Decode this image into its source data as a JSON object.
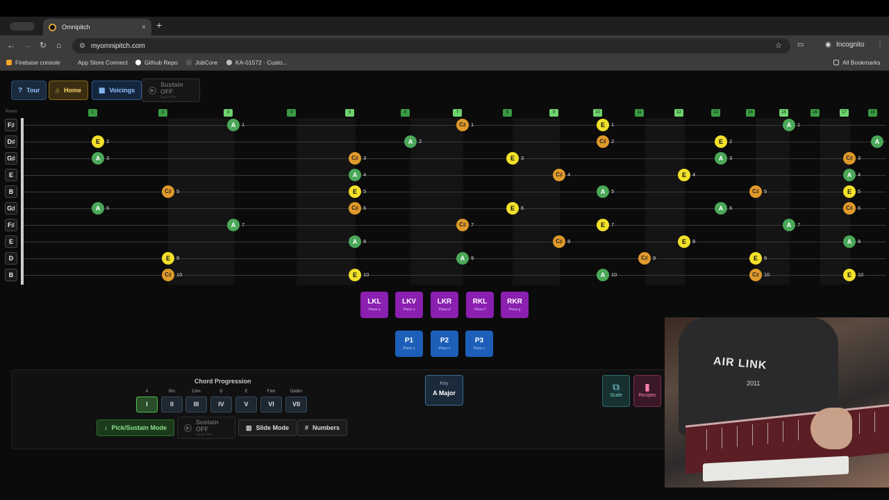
{
  "browser": {
    "tab_title": "Omnipitch",
    "tab_close": "×",
    "new_tab": "+",
    "url": "myomnipitch.com",
    "incognito": "Incognito",
    "bookmarks": [
      {
        "label": "Firebase console",
        "color": "#f5a623"
      },
      {
        "label": "App Store Connect",
        "color": "#3a3a3a"
      },
      {
        "label": "Github Repo",
        "color": "#ffffff"
      },
      {
        "label": "JobCore",
        "color": "#555555"
      },
      {
        "label": "KA-01572 · Custo...",
        "color": "#bbbbbb"
      }
    ],
    "all_bookmarks": "All Bookmarks"
  },
  "top_buttons": {
    "tour": "Tour",
    "home": "Home",
    "voicings": "Voicings",
    "sustain": "Sustain OFF",
    "sustain_sub": "Space Bar"
  },
  "press_label": "Press",
  "frets": [
    "1",
    "2",
    "3",
    "4",
    "5",
    "6",
    "7",
    "8",
    "9",
    "10",
    "11",
    "12",
    "13",
    "14",
    "15",
    "16",
    "17",
    "18"
  ],
  "strings": [
    "F♯",
    "D♯",
    "G♯",
    "E",
    "B",
    "G♯",
    "F♯",
    "E",
    "D",
    "B"
  ],
  "notes": [
    {
      "s": 0,
      "f": 3,
      "n": "A",
      "d": "1"
    },
    {
      "s": 0,
      "f": 7,
      "n": "C♯",
      "d": "1"
    },
    {
      "s": 0,
      "f": 10,
      "n": "E",
      "d": "1"
    },
    {
      "s": 0,
      "f": 15,
      "n": "A",
      "d": "1"
    },
    {
      "s": 1,
      "f": 1,
      "n": "E",
      "d": "2"
    },
    {
      "s": 1,
      "f": 6,
      "n": "A",
      "d": "2"
    },
    {
      "s": 1,
      "f": 10,
      "n": "C♯",
      "d": "2"
    },
    {
      "s": 1,
      "f": 13,
      "n": "E",
      "d": "2"
    },
    {
      "s": 1,
      "f": 18,
      "n": "A",
      "d": ""
    },
    {
      "s": 2,
      "f": 1,
      "n": "A",
      "d": "3"
    },
    {
      "s": 2,
      "f": 5,
      "n": "C♯",
      "d": "3"
    },
    {
      "s": 2,
      "f": 8,
      "n": "E",
      "d": "3"
    },
    {
      "s": 2,
      "f": 13,
      "n": "A",
      "d": "3"
    },
    {
      "s": 2,
      "f": 17,
      "n": "C♯",
      "d": "3"
    },
    {
      "s": 3,
      "f": 5,
      "n": "A",
      "d": "4"
    },
    {
      "s": 3,
      "f": 9,
      "n": "C♯",
      "d": "4"
    },
    {
      "s": 3,
      "f": 12,
      "n": "E",
      "d": "4"
    },
    {
      "s": 3,
      "f": 17,
      "n": "A",
      "d": "4"
    },
    {
      "s": 4,
      "f": 2,
      "n": "C♯",
      "d": "5"
    },
    {
      "s": 4,
      "f": 5,
      "n": "E",
      "d": "5"
    },
    {
      "s": 4,
      "f": 10,
      "n": "A",
      "d": "5"
    },
    {
      "s": 4,
      "f": 14,
      "n": "C♯",
      "d": "5"
    },
    {
      "s": 4,
      "f": 17,
      "n": "E",
      "d": "5"
    },
    {
      "s": 5,
      "f": 1,
      "n": "A",
      "d": "6"
    },
    {
      "s": 5,
      "f": 5,
      "n": "C♯",
      "d": "6"
    },
    {
      "s": 5,
      "f": 8,
      "n": "E",
      "d": "6"
    },
    {
      "s": 5,
      "f": 13,
      "n": "A",
      "d": "6"
    },
    {
      "s": 5,
      "f": 17,
      "n": "C♯",
      "d": "6"
    },
    {
      "s": 6,
      "f": 3,
      "n": "A",
      "d": "7"
    },
    {
      "s": 6,
      "f": 7,
      "n": "C♯",
      "d": "7"
    },
    {
      "s": 6,
      "f": 10,
      "n": "E",
      "d": "7"
    },
    {
      "s": 6,
      "f": 15,
      "n": "A",
      "d": "7"
    },
    {
      "s": 7,
      "f": 5,
      "n": "A",
      "d": "8"
    },
    {
      "s": 7,
      "f": 9,
      "n": "C♯",
      "d": "8"
    },
    {
      "s": 7,
      "f": 12,
      "n": "E",
      "d": "8"
    },
    {
      "s": 7,
      "f": 17,
      "n": "A",
      "d": "8"
    },
    {
      "s": 8,
      "f": 2,
      "n": "E",
      "d": "9"
    },
    {
      "s": 8,
      "f": 7,
      "n": "A",
      "d": "9"
    },
    {
      "s": 8,
      "f": 11,
      "n": "C♯",
      "d": "9"
    },
    {
      "s": 8,
      "f": 14,
      "n": "E",
      "d": "9"
    },
    {
      "s": 9,
      "f": 2,
      "n": "C♯",
      "d": "10"
    },
    {
      "s": 9,
      "f": 5,
      "n": "E",
      "d": "10"
    },
    {
      "s": 9,
      "f": 10,
      "n": "A",
      "d": "10"
    },
    {
      "s": 9,
      "f": 14,
      "n": "C♯",
      "d": "10"
    },
    {
      "s": 9,
      "f": 17,
      "n": "E",
      "d": "10"
    }
  ],
  "pedals": [
    {
      "label": "LKL",
      "key": "Press a"
    },
    {
      "label": "LKV",
      "key": "Press s"
    },
    {
      "label": "LKR",
      "key": "Press d"
    },
    {
      "label": "RKL",
      "key": "Press f"
    },
    {
      "label": "RKR",
      "key": "Press g"
    }
  ],
  "pedals_p": [
    {
      "label": "P1",
      "key": "Press z"
    },
    {
      "label": "P2",
      "key": "Press x"
    },
    {
      "label": "P3",
      "key": "Press c"
    }
  ],
  "chord_progression": {
    "title": "Chord Progression",
    "chords": [
      {
        "name": "A",
        "numeral": "I"
      },
      {
        "name": "Bm",
        "numeral": "II"
      },
      {
        "name": "C♯m",
        "numeral": "III"
      },
      {
        "name": "D",
        "numeral": "IV"
      },
      {
        "name": "E",
        "numeral": "V"
      },
      {
        "name": "F♯m",
        "numeral": "VI"
      },
      {
        "name": "G♯dim",
        "numeral": "VII"
      }
    ],
    "pick_mode": "Pick/Sustain Mode",
    "sustain": "Sustain OFF",
    "sustain_sub": "Space Bar",
    "slide_mode": "Slide Mode",
    "numbers": "Numbers"
  },
  "key": {
    "label": "Key",
    "value": "A Major"
  },
  "side_buttons": {
    "scale": "Scale",
    "recipes": "Recipes"
  },
  "webcam": {
    "shirt_text": "AIR LINK",
    "shirt_sub": "2011"
  }
}
